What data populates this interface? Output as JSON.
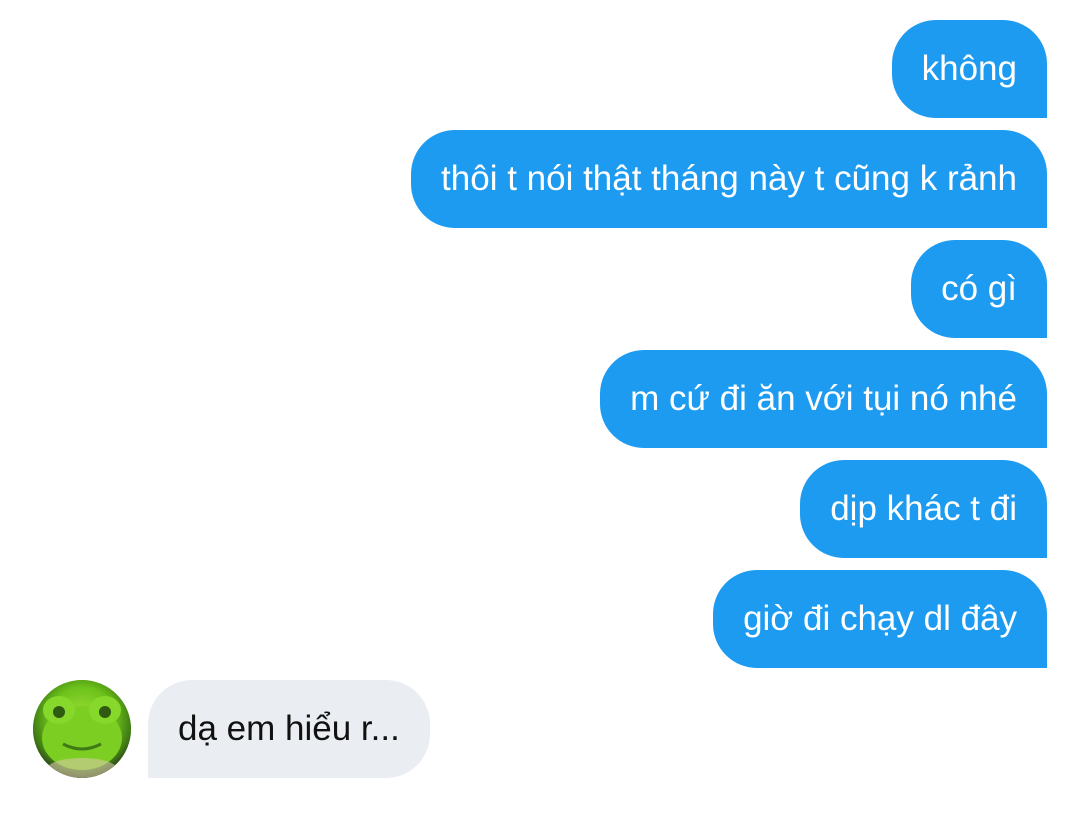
{
  "messages": [
    {
      "direction": "outgoing",
      "text": "không"
    },
    {
      "direction": "outgoing",
      "text": "thôi t nói thật tháng này t cũng k rảnh"
    },
    {
      "direction": "outgoing",
      "text": "có gì"
    },
    {
      "direction": "outgoing",
      "text": "m cứ đi ăn với tụi nó nhé"
    },
    {
      "direction": "outgoing",
      "text": "dịp khác t đi"
    },
    {
      "direction": "outgoing",
      "text": "giờ đi chạy dl đây"
    },
    {
      "direction": "incoming",
      "text": "dạ em hiểu r..."
    }
  ],
  "contact": {
    "avatar_icon": "green-frog-plush-avatar"
  },
  "colors": {
    "outgoing_bubble": "#1d9bf0",
    "incoming_bubble": "#eaeef2",
    "background": "#ffffff"
  }
}
